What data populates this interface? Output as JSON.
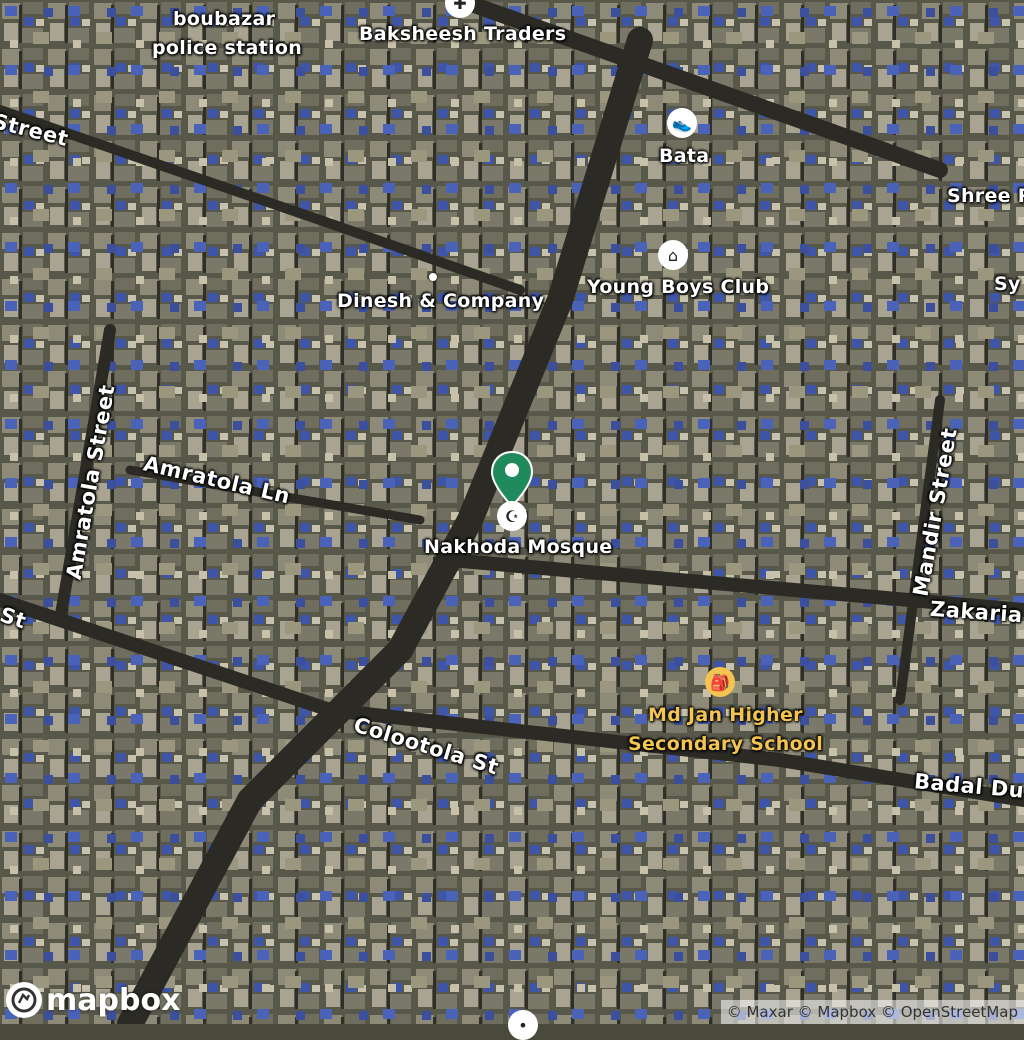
{
  "map": {
    "imagery": "satellite",
    "colors": {
      "road_label": "#ffffff",
      "school_label": "#f4c451",
      "marker": "#1f8a5b"
    }
  },
  "labels": {
    "boubazar_line1": "boubazar",
    "boubazar_line2": "police station",
    "baksheesh": "Baksheesh Traders",
    "bata": "Bata",
    "shree": "Shree P",
    "sym": "Sy",
    "young_boys": "Young Boys Club",
    "dinesh": "Dinesh & Company",
    "nakhoda": "Nakhoda Mosque",
    "school_line1": "Md Jan Higher",
    "school_line2": "Secondary School"
  },
  "streets": {
    "street_top": "Street",
    "amratola_street": "Amratola Street",
    "amratola_ln": "Amratola Ln",
    "st_left": "St",
    "mandir": "Mandir Street",
    "zakaria": "Zakaria",
    "colootola": "Colootola St",
    "badal": "Badal Du"
  },
  "icons": {
    "hospital": "hospital-icon",
    "shoe": "shoe-shop-icon",
    "club": "community-club-icon",
    "mosque": "mosque-icon",
    "school": "school-icon",
    "marker": "map-pin-icon"
  },
  "branding": {
    "logo_text": "mapbox"
  },
  "attribution": "© Maxar © Mapbox © OpenStreetMap"
}
